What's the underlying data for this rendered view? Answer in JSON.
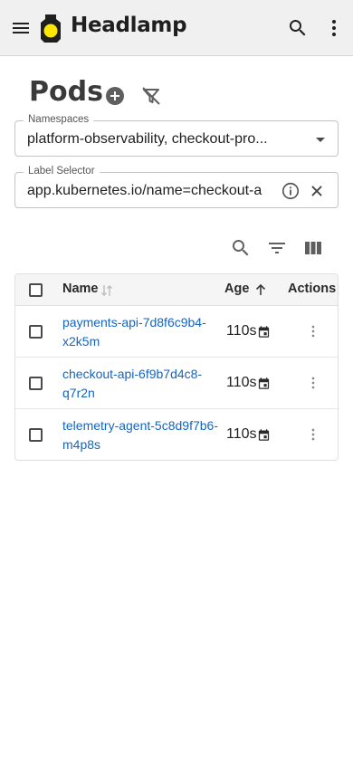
{
  "app": {
    "brand": "Headlamp",
    "colors": {
      "logo_yellow": "#ffe600",
      "link": "#1565c0",
      "appbar_bg": "#f0f0f0"
    }
  },
  "icons": {
    "menu": "hamburger-menu-icon",
    "logo": "headlamp-logo",
    "search": "search-icon",
    "more": "more-vertical-icon",
    "add": "add-circle-icon",
    "filter_clear": "filter-off-icon",
    "dropdown": "arrow-drop-down-icon",
    "info": "info-icon",
    "clear": "close-icon",
    "table_search": "search-icon",
    "table_filter": "filter-list-icon",
    "table_columns": "view-column-icon",
    "calendar": "calendar-icon"
  },
  "page": {
    "title": "Pods"
  },
  "filters": {
    "namespaces": {
      "label": "Namespaces",
      "value": "platform-observability, checkout-pro..."
    },
    "label_selector": {
      "label": "Label Selector",
      "value": "app.kubernetes.io/name=checkout-a"
    }
  },
  "table": {
    "columns": {
      "name": "Name",
      "age": "Age",
      "actions": "Actions"
    },
    "sort": {
      "column": "Age",
      "direction": "ascending"
    },
    "rows": [
      {
        "name": "payments-api-7d8f6c9b4-x2k5m",
        "age": "110s"
      },
      {
        "name": "checkout-api-6f9b7d4c8-q7r2n",
        "age": "110s"
      },
      {
        "name": "telemetry-agent-5c8d9f7b6-m4p8s",
        "age": "110s"
      }
    ]
  }
}
